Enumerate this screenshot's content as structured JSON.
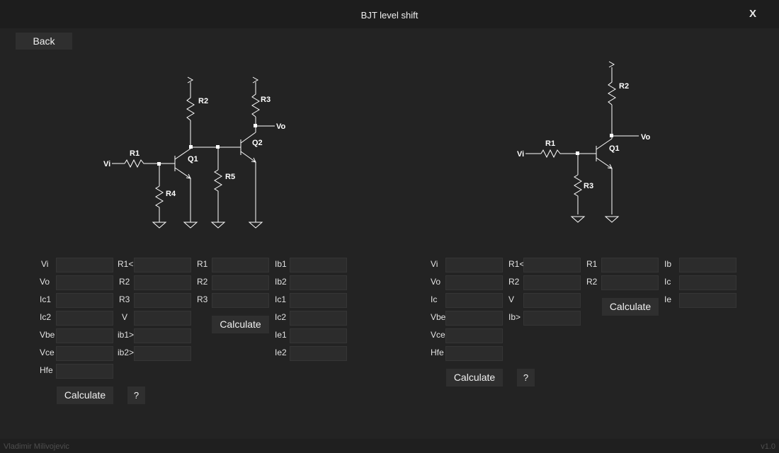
{
  "window": {
    "title": "BJT level shift",
    "close_label": "X"
  },
  "back_label": "Back",
  "left_schematic": {
    "labels": {
      "vi": "Vi",
      "r1": "R1",
      "r2": "R2",
      "r3": "R3",
      "r4": "R4",
      "r5": "R5",
      "q1": "Q1",
      "q2": "Q2",
      "vo": "Vo"
    }
  },
  "right_schematic": {
    "labels": {
      "vi": "Vi",
      "r1": "R1",
      "r2": "R2",
      "r3": "R3",
      "q1": "Q1",
      "vo": "Vo"
    }
  },
  "left_form": {
    "col1": [
      {
        "label": "Vi",
        "value": ""
      },
      {
        "label": "Vo",
        "value": ""
      },
      {
        "label": "Ic1",
        "value": ""
      },
      {
        "label": "Ic2",
        "value": ""
      },
      {
        "label": "Vbe",
        "value": ""
      },
      {
        "label": "Vce",
        "value": ""
      },
      {
        "label": "Hfe",
        "value": ""
      }
    ],
    "col2": [
      {
        "label": "R1<",
        "value": ""
      },
      {
        "label": "R2",
        "value": ""
      },
      {
        "label": "R3",
        "value": ""
      },
      {
        "label": "V",
        "value": ""
      },
      {
        "label": "ib1>",
        "value": ""
      },
      {
        "label": "ib2>",
        "value": ""
      }
    ],
    "col3": [
      {
        "label": "R1",
        "value": ""
      },
      {
        "label": "R2",
        "value": ""
      },
      {
        "label": "R3",
        "value": ""
      }
    ],
    "col4": [
      {
        "label": "Ib1",
        "value": ""
      },
      {
        "label": "Ib2",
        "value": ""
      },
      {
        "label": "Ic1",
        "value": ""
      },
      {
        "label": "Ic2",
        "value": ""
      },
      {
        "label": "Ie1",
        "value": ""
      },
      {
        "label": "Ie2",
        "value": ""
      }
    ],
    "calculate_inner_label": "Calculate",
    "calculate_label": "Calculate",
    "help_label": "?"
  },
  "right_form": {
    "col1": [
      {
        "label": "Vi",
        "value": ""
      },
      {
        "label": "Vo",
        "value": ""
      },
      {
        "label": "Ic",
        "value": ""
      },
      {
        "label": "Vbe",
        "value": ""
      },
      {
        "label": "Vce",
        "value": ""
      },
      {
        "label": "Hfe",
        "value": ""
      }
    ],
    "col2": [
      {
        "label": "R1<",
        "value": ""
      },
      {
        "label": "R2",
        "value": ""
      },
      {
        "label": "V",
        "value": ""
      },
      {
        "label": "Ib>",
        "value": ""
      }
    ],
    "col3": [
      {
        "label": "R1",
        "value": ""
      },
      {
        "label": "R2",
        "value": ""
      }
    ],
    "col4": [
      {
        "label": "Ib",
        "value": ""
      },
      {
        "label": "Ic",
        "value": ""
      },
      {
        "label": "Ie",
        "value": ""
      }
    ],
    "calculate_inner_label": "Calculate",
    "calculate_label": "Calculate",
    "help_label": "?"
  },
  "footer": {
    "author": "Vladimir Milivojevic",
    "version": "v1.0"
  }
}
